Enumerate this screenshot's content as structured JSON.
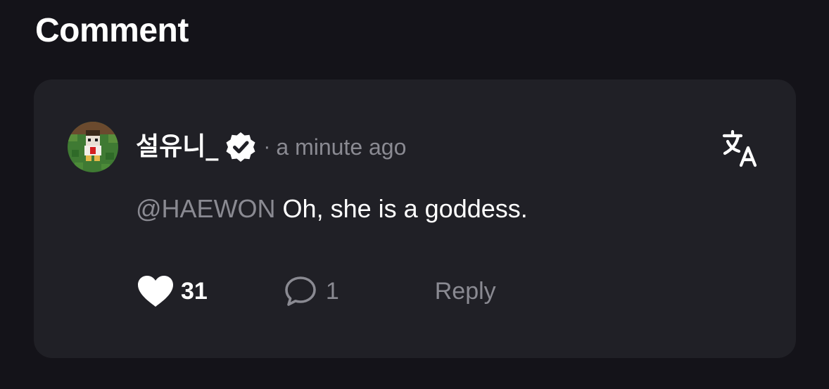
{
  "section": {
    "title": "Comment"
  },
  "comment": {
    "avatar_icon": "pixel-character-avatar",
    "username": "설유니_",
    "verified_icon": "verified-badge-icon",
    "separator": "·",
    "timestamp": "a minute ago",
    "translate_icon": "translate-icon",
    "mention": "@HAEWON",
    "body": " Oh, she is a goddess.",
    "likes": "31",
    "like_icon": "heart-icon",
    "replies": "1",
    "reply_count_icon": "speech-bubble-icon",
    "reply_label": "Reply"
  },
  "colors": {
    "background": "#141319",
    "card": "#202026",
    "primary_text": "#ffffff",
    "muted_text": "#8a8a92"
  }
}
